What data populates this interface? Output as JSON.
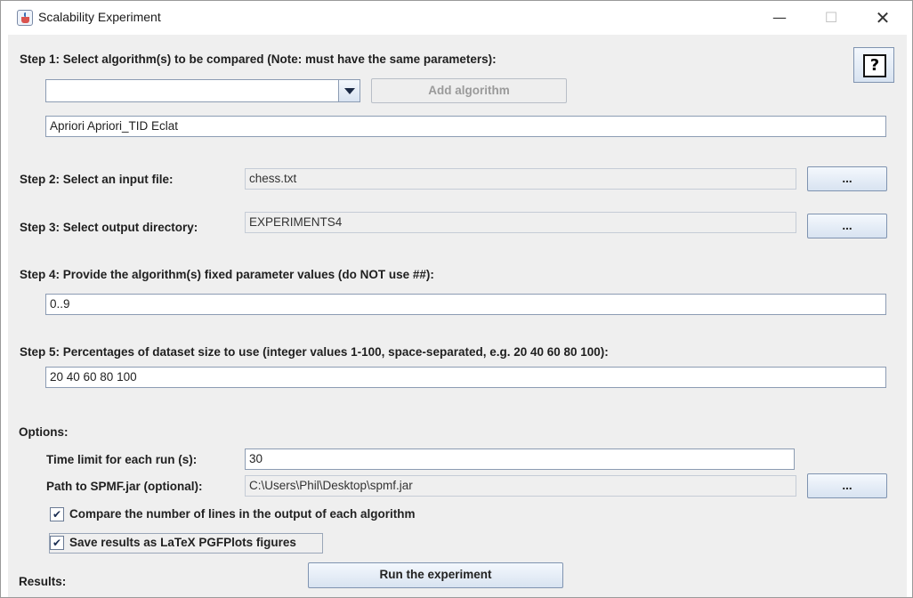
{
  "window": {
    "title": "Scalability Experiment",
    "controls": {
      "minimize": "—",
      "maximize": "☐",
      "close": "✕"
    }
  },
  "help": {
    "label": "?"
  },
  "step1": {
    "label": "Step 1: Select algorithm(s) to be compared (Note: must have the same parameters):",
    "combo_value": "",
    "add_button": "Add algorithm",
    "selected_algorithms": "Apriori Apriori_TID Eclat"
  },
  "step2": {
    "label": "Step 2: Select an input file:",
    "value": "chess.txt",
    "browse": "..."
  },
  "step3": {
    "label": "Step 3: Select output directory:",
    "value": "EXPERIMENTS4",
    "browse": "..."
  },
  "step4": {
    "label": "Step 4: Provide the algorithm(s) fixed parameter values (do NOT use ##):",
    "value": "0..9"
  },
  "step5": {
    "label": "Step 5: Percentages of dataset size to use (integer values 1-100, space-separated, e.g. 20 40 60 80 100):",
    "value": "20 40 60 80 100"
  },
  "options": {
    "label": "Options:",
    "time_limit_label": "Time limit for each run (s):",
    "time_limit_value": "30",
    "spmf_label": "Path to SPMF.jar (optional):",
    "spmf_value": "C:\\Users\\Phil\\Desktop\\spmf.jar",
    "spmf_browse": "...",
    "compare_lines": {
      "label": "Compare the number of lines in the output of each algorithm",
      "checked": true,
      "mark": "✔"
    },
    "save_latex": {
      "label": "Save results as LaTeX PGFPlots figures",
      "checked": true,
      "mark": "✔"
    }
  },
  "run_button": "Run the experiment",
  "results_label": "Results:"
}
